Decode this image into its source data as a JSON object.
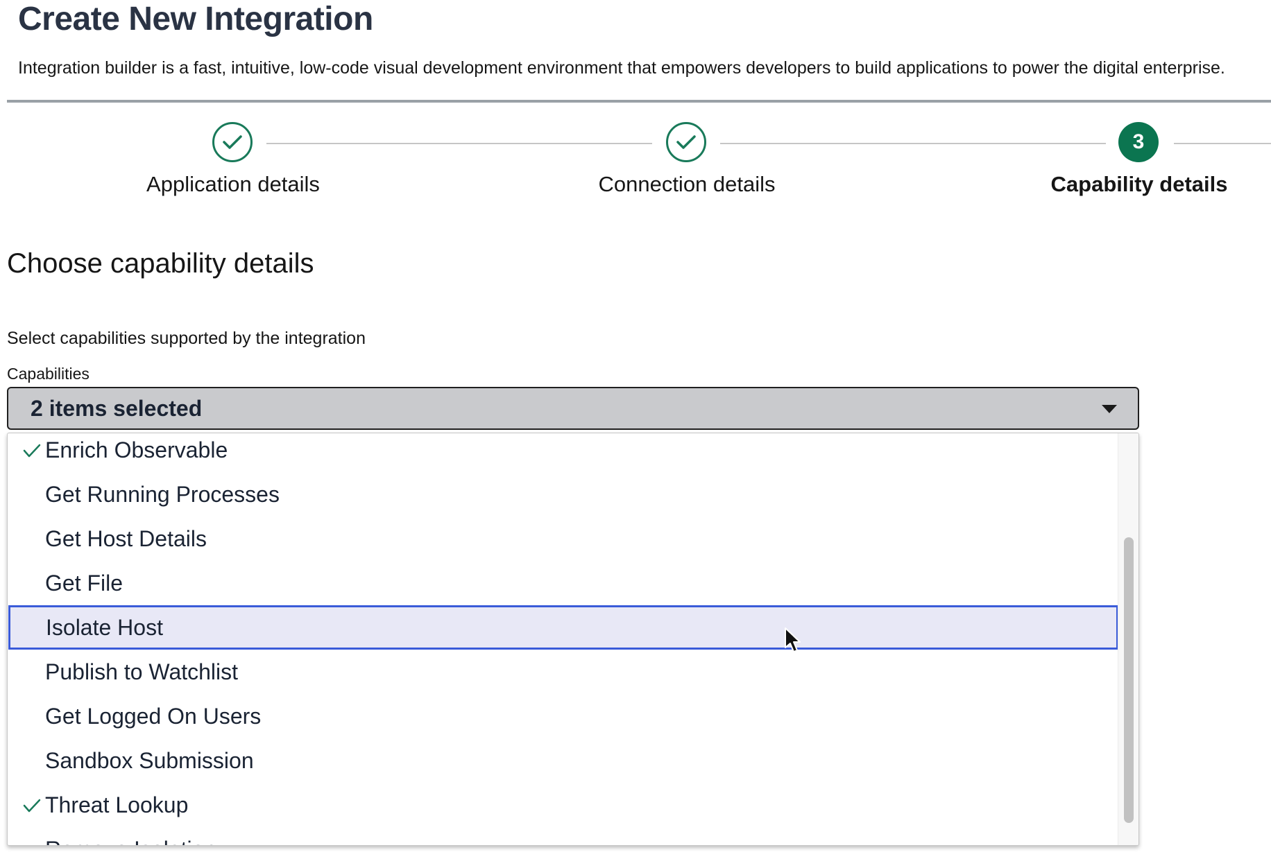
{
  "header": {
    "title": "Create New Integration",
    "subtitle": "Integration builder is a fast, intuitive, low-code visual development environment that empowers developers to build applications to power the digital enterprise."
  },
  "stepper": {
    "steps": [
      {
        "label": "Application details",
        "state": "complete"
      },
      {
        "label": "Connection details",
        "state": "complete"
      },
      {
        "label": "Capability details",
        "state": "current",
        "number": "3"
      }
    ]
  },
  "section": {
    "heading": "Choose capability details",
    "helper": "Select capabilities supported by the integration"
  },
  "capabilities": {
    "label": "Capabilities",
    "summary": "2 items selected",
    "options": [
      {
        "label": "Enrich Observable",
        "selected": true
      },
      {
        "label": "Get Running Processes",
        "selected": false
      },
      {
        "label": "Get Host Details",
        "selected": false
      },
      {
        "label": "Get File",
        "selected": false
      },
      {
        "label": "Isolate Host",
        "selected": false,
        "focused": true
      },
      {
        "label": "Publish to Watchlist",
        "selected": false
      },
      {
        "label": "Get Logged On Users",
        "selected": false
      },
      {
        "label": "Sandbox Submission",
        "selected": false
      },
      {
        "label": "Threat Lookup",
        "selected": true
      },
      {
        "label": "Remove Isolation",
        "selected": false
      }
    ]
  },
  "colors": {
    "accent": "#0b7550",
    "focus": "#3a5bd9",
    "focus_bg": "#e8e8f6",
    "dropdown_bg": "#c9cacd"
  }
}
